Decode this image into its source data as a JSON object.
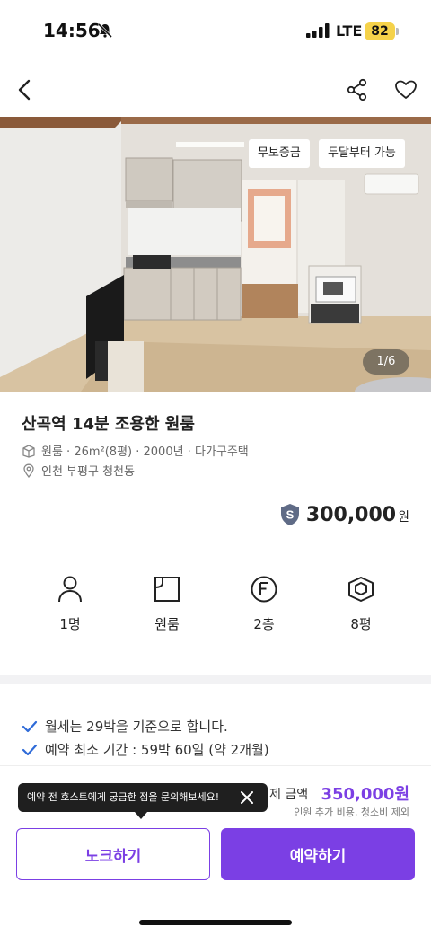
{
  "status_bar": {
    "time": "14:56",
    "network": "LTE",
    "battery": "82"
  },
  "hero": {
    "tags": [
      "무보증금",
      "두달부터 가능"
    ],
    "counter": "1/6"
  },
  "listing": {
    "title": "산곡역 14분 조용한 원룸",
    "details": "원룸 · 26m²(8평) · 2000년 · 다가구주택",
    "location": "인천 부평구 청천동",
    "price": "300,000",
    "price_unit": "원"
  },
  "features": [
    {
      "icon": "person-icon",
      "label": "1명"
    },
    {
      "icon": "room-icon",
      "label": "원룸"
    },
    {
      "icon": "floor-icon",
      "label": "2층"
    },
    {
      "icon": "area-icon",
      "label": "8평"
    }
  ],
  "rules": [
    "월세는 29박을 기준으로 합니다.",
    "예약 최소 기간 : 59박 60일 (약 2개월)"
  ],
  "bottom": {
    "total_label": "제 금액",
    "total_value": "350,000원",
    "total_note": "인원 추가 비용, 청소비 제외",
    "tooltip": "예약 전 호스트에게 궁금한 점을 문의해보세요!",
    "knock_label": "노크하기",
    "book_label": "예약하기"
  },
  "colors": {
    "accent": "#7b3fe4",
    "badge": "#f5d24a"
  }
}
